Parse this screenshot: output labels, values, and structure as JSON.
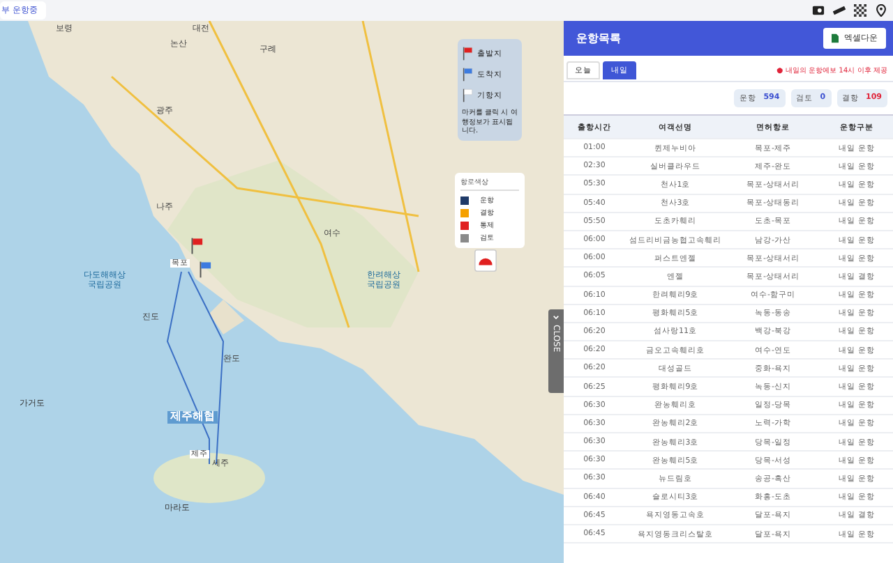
{
  "top_bar": {
    "status_chip": "부 운항중"
  },
  "map": {
    "labels": [
      {
        "text": "보령",
        "kind": "city"
      },
      {
        "text": "대전",
        "kind": "city"
      },
      {
        "text": "논산",
        "kind": "city"
      },
      {
        "text": "구례",
        "kind": "city"
      },
      {
        "text": "광주",
        "kind": "city"
      },
      {
        "text": "나주",
        "kind": "city"
      },
      {
        "text": "목포",
        "kind": "port"
      },
      {
        "text": "여수",
        "kind": "city"
      },
      {
        "text": "진도",
        "kind": "city"
      },
      {
        "text": "완도",
        "kind": "city"
      },
      {
        "text": "다도해해상\n국립공원",
        "kind": "park"
      },
      {
        "text": "한려해상\n국립공원",
        "kind": "park"
      },
      {
        "text": "가거도",
        "kind": "island"
      },
      {
        "text": "제주해협",
        "kind": "sea"
      },
      {
        "text": "제주",
        "kind": "port"
      },
      {
        "text": "세주",
        "kind": "city"
      },
      {
        "text": "마라도",
        "kind": "island"
      }
    ],
    "legend": {
      "items": [
        {
          "label": "출발지",
          "kind": "start"
        },
        {
          "label": "도착지",
          "kind": "arrive"
        },
        {
          "label": "기항지",
          "kind": "stop"
        }
      ],
      "note": "마커를 클릭 시 여행정보가 표시됩니다."
    },
    "route_colors": {
      "title": "항로색상",
      "items": [
        {
          "label": "운항",
          "color": "#1f3a68"
        },
        {
          "label": "결항",
          "color": "#f5a000"
        },
        {
          "label": "통제",
          "color": "#e02020"
        },
        {
          "label": "검토",
          "color": "#8a8a8a"
        }
      ]
    },
    "close_tab": "CLOSE"
  },
  "panel": {
    "title": "운항목록",
    "excel_button": "엑셀다운",
    "tabs": [
      {
        "label": "오늘",
        "selected": false
      },
      {
        "label": "내일",
        "selected": true
      }
    ],
    "notice": "● 내일의 운항예보 14시 이후 제공",
    "counts": [
      {
        "label": "운항",
        "value": "594",
        "color": "#3b4fd0"
      },
      {
        "label": "검토",
        "value": "0",
        "color": "#3b4fd0"
      },
      {
        "label": "결항",
        "value": "109",
        "color": "#e0243a"
      }
    ],
    "columns": [
      "출항시간",
      "여객선명",
      "면허항로",
      "운항구분"
    ],
    "rows": [
      [
        "01:00",
        "퀸제누비아",
        "목포-제주",
        "내일 운항"
      ],
      [
        "02:30",
        "실버클라우드",
        "제주-완도",
        "내일 운항"
      ],
      [
        "05:30",
        "천사1호",
        "목포-상태서리",
        "내일 운항"
      ],
      [
        "05:40",
        "천사3호",
        "목포-상태동리",
        "내일 운항"
      ],
      [
        "05:50",
        "도초카훼리",
        "도초-목포",
        "내일 운항"
      ],
      [
        "06:00",
        "섬드리비금농협고속훼리",
        "남강-가산",
        "내일 운항"
      ],
      [
        "06:00",
        "퍼스트엔젤",
        "목포-상태서리",
        "내일 운항"
      ],
      [
        "06:05",
        "엔젤",
        "목포-상태서리",
        "내일 결항"
      ],
      [
        "06:10",
        "한려훼리9호",
        "여수-함구미",
        "내일 운항"
      ],
      [
        "06:10",
        "평화훼리5호",
        "녹동-동송",
        "내일 운항"
      ],
      [
        "06:20",
        "섬사랑11호",
        "백강-북강",
        "내일 운항"
      ],
      [
        "06:20",
        "금오고속훼리호",
        "여수-연도",
        "내일 운항"
      ],
      [
        "06:20",
        "대성골드",
        "중화-욕지",
        "내일 운항"
      ],
      [
        "06:25",
        "평화훼리9호",
        "녹동-신지",
        "내일 운항"
      ],
      [
        "06:30",
        "완농훼리호",
        "일정-당목",
        "내일 운항"
      ],
      [
        "06:30",
        "완농훼리2호",
        "노력-가학",
        "내일 운항"
      ],
      [
        "06:30",
        "완농훼리3호",
        "당목-일정",
        "내일 운항"
      ],
      [
        "06:30",
        "완농훼리5호",
        "당목-서성",
        "내일 운항"
      ],
      [
        "06:30",
        "뉴드림호",
        "송공-흑산",
        "내일 운항"
      ],
      [
        "06:40",
        "슬로시티3호",
        "화흥-도초",
        "내일 운항"
      ],
      [
        "06:45",
        "욕지영동고속호",
        "달포-욕지",
        "내일 결항"
      ],
      [
        "06:45",
        "욕지영동크리스탈호",
        "달포-욕지",
        "내일 운항"
      ]
    ]
  }
}
